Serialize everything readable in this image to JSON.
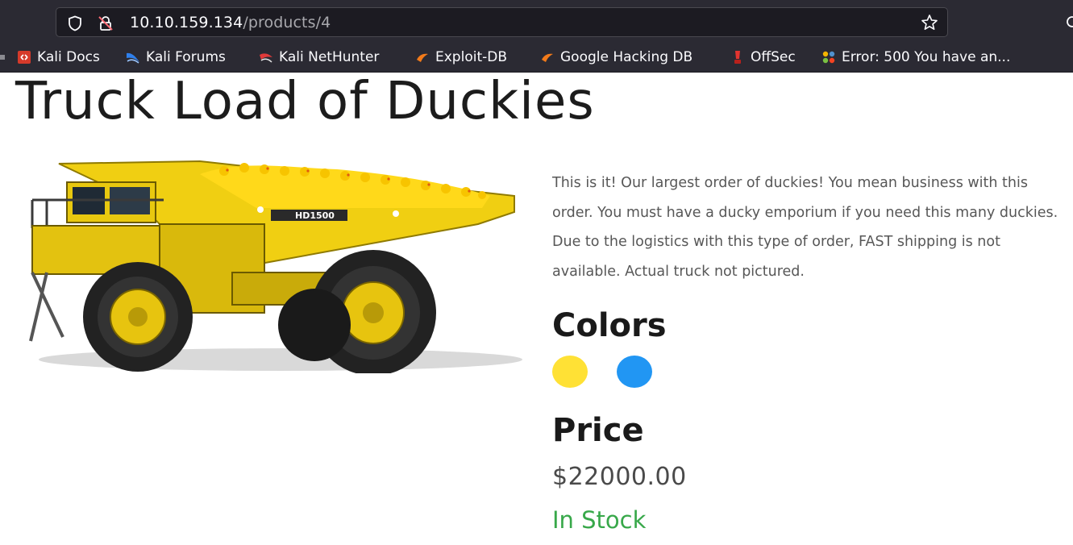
{
  "browser": {
    "url_host": "10.10.159.134",
    "url_path": "/products/4",
    "icons": {
      "tracking": "shield-icon",
      "security": "insecure-lock-icon",
      "bookmark": "star-icon"
    },
    "bookmarks": [
      {
        "label": "Kali Docs",
        "icon": "kali-docs-icon",
        "color": "#d63a2a"
      },
      {
        "label": "Kali Forums",
        "icon": "kali-forums-icon",
        "color": "#2f80ed"
      },
      {
        "label": "Kali NetHunter",
        "icon": "kali-nethunter-icon",
        "color": "#e03a3a"
      },
      {
        "label": "Exploit-DB",
        "icon": "exploit-db-icon",
        "color": "#f27a1a"
      },
      {
        "label": "Google Hacking DB",
        "icon": "ghdb-icon",
        "color": "#f27a1a"
      },
      {
        "label": "OffSec",
        "icon": "offsec-icon",
        "color": "#e3342f"
      },
      {
        "label": "Error: 500 You have an...",
        "icon": "joomla-icon",
        "color": "#f4b400"
      }
    ]
  },
  "product": {
    "title": "Truck Load of Duckies",
    "image": "yellow-dump-truck-full-of-rubber-duckies",
    "truck_model": "HD1500",
    "description": "This is it! Our largest order of duckies! You mean business with this order. You must have a ducky emporium if you need this many duckies. Due to the logistics with this type of order, FAST shipping is not available. Actual truck not pictured.",
    "colors_heading": "Colors",
    "colors": [
      {
        "name": "yellow",
        "hex": "#ffe135"
      },
      {
        "name": "blue",
        "hex": "#2196f3"
      }
    ],
    "price_heading": "Price",
    "price": "$22000.00",
    "stock_status": "In Stock",
    "stock_color": "#38a84a"
  }
}
